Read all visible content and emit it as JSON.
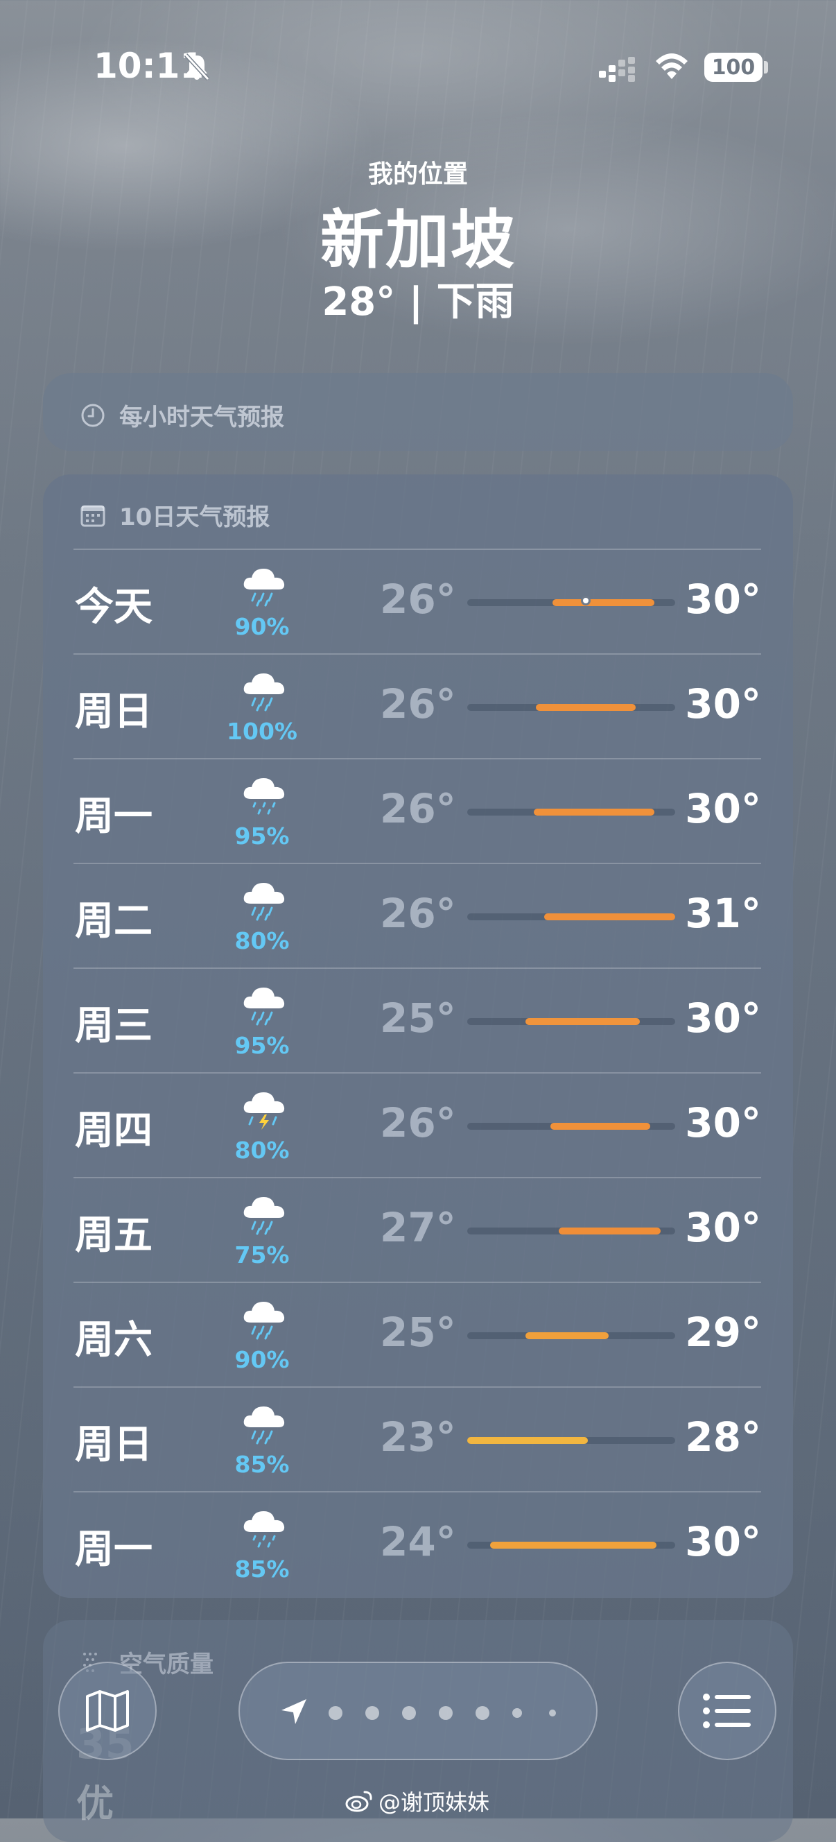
{
  "status_bar": {
    "time": "10:11",
    "battery": "100",
    "icons": [
      "bell-slash-icon",
      "signal-icon",
      "wifi-icon",
      "battery-icon"
    ]
  },
  "header": {
    "location_label": "我的位置",
    "city": "新加坡",
    "current": "28° | 下雨"
  },
  "hourly_card": {
    "title": "每小时天气预报",
    "icon": "clock-icon"
  },
  "daily_card": {
    "title": "10日天气预报",
    "icon": "calendar-icon",
    "days": [
      {
        "day": "今天",
        "icon": "cloud-rain-icon",
        "precip": "90%",
        "low": "26°",
        "high": "30°",
        "bar_start": 0.41,
        "bar_end": 0.9,
        "bar_color": "#f0913a",
        "current_marker": 0.57
      },
      {
        "day": "周日",
        "icon": "cloud-rain-icon",
        "precip": "100%",
        "low": "26°",
        "high": "30°",
        "bar_start": 0.33,
        "bar_end": 0.81,
        "bar_color": "#f0913a"
      },
      {
        "day": "周一",
        "icon": "cloud-drizzle-icon",
        "precip": "95%",
        "low": "26°",
        "high": "30°",
        "bar_start": 0.32,
        "bar_end": 0.9,
        "bar_color": "#f0913a"
      },
      {
        "day": "周二",
        "icon": "cloud-rain-icon",
        "precip": "80%",
        "low": "26°",
        "high": "31°",
        "bar_start": 0.37,
        "bar_end": 1.0,
        "bar_color": "#f0903a"
      },
      {
        "day": "周三",
        "icon": "cloud-rain-icon",
        "precip": "95%",
        "low": "25°",
        "high": "30°",
        "bar_start": 0.28,
        "bar_end": 0.83,
        "bar_color": "#f0943c"
      },
      {
        "day": "周四",
        "icon": "cloud-bolt-rain-icon",
        "precip": "80%",
        "low": "26°",
        "high": "30°",
        "bar_start": 0.4,
        "bar_end": 0.88,
        "bar_color": "#f0913a"
      },
      {
        "day": "周五",
        "icon": "cloud-rain-icon",
        "precip": "75%",
        "low": "27°",
        "high": "30°",
        "bar_start": 0.44,
        "bar_end": 0.93,
        "bar_color": "#f08e38"
      },
      {
        "day": "周六",
        "icon": "cloud-rain-icon",
        "precip": "90%",
        "low": "25°",
        "high": "29°",
        "bar_start": 0.28,
        "bar_end": 0.68,
        "bar_color": "#f0a03c"
      },
      {
        "day": "周日",
        "icon": "cloud-rain-icon",
        "precip": "85%",
        "low": "23°",
        "high": "28°",
        "bar_start": 0.0,
        "bar_end": 0.58,
        "bar_color": "#f2b640"
      },
      {
        "day": "周一",
        "icon": "cloud-drizzle-icon",
        "precip": "85%",
        "low": "24°",
        "high": "30°",
        "bar_start": 0.11,
        "bar_end": 0.91,
        "bar_color": "#f0a23c"
      }
    ]
  },
  "aqi_card": {
    "title": "空气质量",
    "value": "35",
    "level": "优"
  },
  "bottom_bar": {
    "map_icon": "map-icon",
    "list_icon": "list-icon",
    "location_icon": "location-arrow-icon",
    "page_count": 7
  },
  "watermark": "@谢顶妹妹"
}
